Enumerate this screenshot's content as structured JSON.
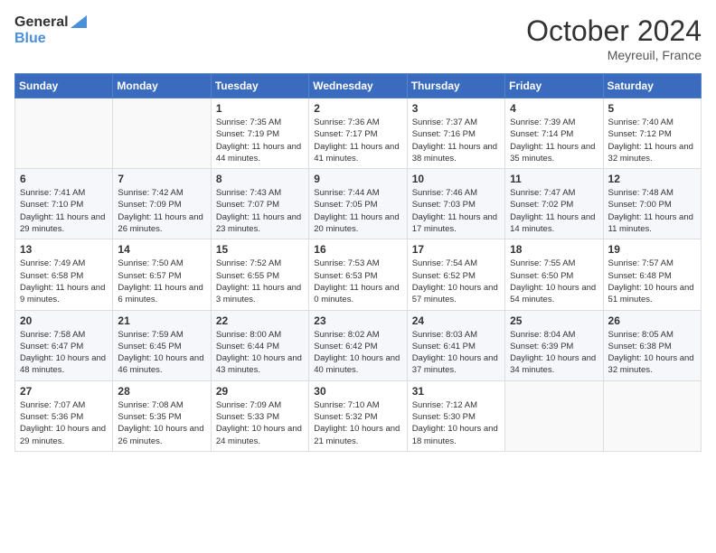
{
  "logo": {
    "line1": "General",
    "line2": "Blue"
  },
  "title": "October 2024",
  "location": "Meyreuil, France",
  "weekdays": [
    "Sunday",
    "Monday",
    "Tuesday",
    "Wednesday",
    "Thursday",
    "Friday",
    "Saturday"
  ],
  "weeks": [
    [
      {
        "day": "",
        "info": ""
      },
      {
        "day": "",
        "info": ""
      },
      {
        "day": "1",
        "info": "Sunrise: 7:35 AM\nSunset: 7:19 PM\nDaylight: 11 hours and 44 minutes."
      },
      {
        "day": "2",
        "info": "Sunrise: 7:36 AM\nSunset: 7:17 PM\nDaylight: 11 hours and 41 minutes."
      },
      {
        "day": "3",
        "info": "Sunrise: 7:37 AM\nSunset: 7:16 PM\nDaylight: 11 hours and 38 minutes."
      },
      {
        "day": "4",
        "info": "Sunrise: 7:39 AM\nSunset: 7:14 PM\nDaylight: 11 hours and 35 minutes."
      },
      {
        "day": "5",
        "info": "Sunrise: 7:40 AM\nSunset: 7:12 PM\nDaylight: 11 hours and 32 minutes."
      }
    ],
    [
      {
        "day": "6",
        "info": "Sunrise: 7:41 AM\nSunset: 7:10 PM\nDaylight: 11 hours and 29 minutes."
      },
      {
        "day": "7",
        "info": "Sunrise: 7:42 AM\nSunset: 7:09 PM\nDaylight: 11 hours and 26 minutes."
      },
      {
        "day": "8",
        "info": "Sunrise: 7:43 AM\nSunset: 7:07 PM\nDaylight: 11 hours and 23 minutes."
      },
      {
        "day": "9",
        "info": "Sunrise: 7:44 AM\nSunset: 7:05 PM\nDaylight: 11 hours and 20 minutes."
      },
      {
        "day": "10",
        "info": "Sunrise: 7:46 AM\nSunset: 7:03 PM\nDaylight: 11 hours and 17 minutes."
      },
      {
        "day": "11",
        "info": "Sunrise: 7:47 AM\nSunset: 7:02 PM\nDaylight: 11 hours and 14 minutes."
      },
      {
        "day": "12",
        "info": "Sunrise: 7:48 AM\nSunset: 7:00 PM\nDaylight: 11 hours and 11 minutes."
      }
    ],
    [
      {
        "day": "13",
        "info": "Sunrise: 7:49 AM\nSunset: 6:58 PM\nDaylight: 11 hours and 9 minutes."
      },
      {
        "day": "14",
        "info": "Sunrise: 7:50 AM\nSunset: 6:57 PM\nDaylight: 11 hours and 6 minutes."
      },
      {
        "day": "15",
        "info": "Sunrise: 7:52 AM\nSunset: 6:55 PM\nDaylight: 11 hours and 3 minutes."
      },
      {
        "day": "16",
        "info": "Sunrise: 7:53 AM\nSunset: 6:53 PM\nDaylight: 11 hours and 0 minutes."
      },
      {
        "day": "17",
        "info": "Sunrise: 7:54 AM\nSunset: 6:52 PM\nDaylight: 10 hours and 57 minutes."
      },
      {
        "day": "18",
        "info": "Sunrise: 7:55 AM\nSunset: 6:50 PM\nDaylight: 10 hours and 54 minutes."
      },
      {
        "day": "19",
        "info": "Sunrise: 7:57 AM\nSunset: 6:48 PM\nDaylight: 10 hours and 51 minutes."
      }
    ],
    [
      {
        "day": "20",
        "info": "Sunrise: 7:58 AM\nSunset: 6:47 PM\nDaylight: 10 hours and 48 minutes."
      },
      {
        "day": "21",
        "info": "Sunrise: 7:59 AM\nSunset: 6:45 PM\nDaylight: 10 hours and 46 minutes."
      },
      {
        "day": "22",
        "info": "Sunrise: 8:00 AM\nSunset: 6:44 PM\nDaylight: 10 hours and 43 minutes."
      },
      {
        "day": "23",
        "info": "Sunrise: 8:02 AM\nSunset: 6:42 PM\nDaylight: 10 hours and 40 minutes."
      },
      {
        "day": "24",
        "info": "Sunrise: 8:03 AM\nSunset: 6:41 PM\nDaylight: 10 hours and 37 minutes."
      },
      {
        "day": "25",
        "info": "Sunrise: 8:04 AM\nSunset: 6:39 PM\nDaylight: 10 hours and 34 minutes."
      },
      {
        "day": "26",
        "info": "Sunrise: 8:05 AM\nSunset: 6:38 PM\nDaylight: 10 hours and 32 minutes."
      }
    ],
    [
      {
        "day": "27",
        "info": "Sunrise: 7:07 AM\nSunset: 5:36 PM\nDaylight: 10 hours and 29 minutes."
      },
      {
        "day": "28",
        "info": "Sunrise: 7:08 AM\nSunset: 5:35 PM\nDaylight: 10 hours and 26 minutes."
      },
      {
        "day": "29",
        "info": "Sunrise: 7:09 AM\nSunset: 5:33 PM\nDaylight: 10 hours and 24 minutes."
      },
      {
        "day": "30",
        "info": "Sunrise: 7:10 AM\nSunset: 5:32 PM\nDaylight: 10 hours and 21 minutes."
      },
      {
        "day": "31",
        "info": "Sunrise: 7:12 AM\nSunset: 5:30 PM\nDaylight: 10 hours and 18 minutes."
      },
      {
        "day": "",
        "info": ""
      },
      {
        "day": "",
        "info": ""
      }
    ]
  ]
}
